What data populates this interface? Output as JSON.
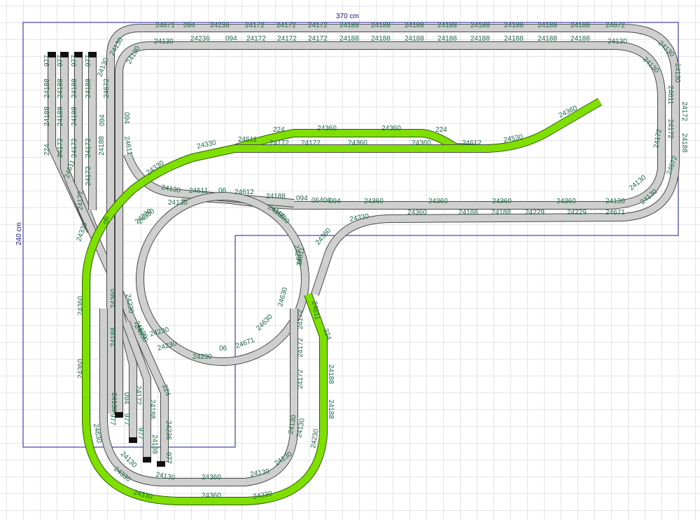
{
  "canvas": {
    "background": "#ffffff",
    "grid_color": "#c9c9d6",
    "board_outline_color": "#1a1aa0",
    "track_color": "#cfcfcf",
    "highlight_color": "#7fe000"
  },
  "dimensions": {
    "width_label": "370 cm",
    "height_label": "240 cm"
  },
  "track_labels": {
    "top_outer": [
      "24671",
      "094",
      "24236",
      "24172",
      "24172",
      "24172",
      "24188",
      "24188",
      "24188",
      "24188",
      "24188",
      "24188",
      "24188",
      "24188",
      "24672"
    ],
    "top_inner": [
      "24130",
      "24236",
      "094",
      "24172",
      "24172",
      "24172",
      "24188",
      "24188",
      "24188",
      "24188",
      "24188",
      "24188",
      "24188",
      "24188",
      "24130"
    ],
    "right_side": [
      "24130",
      "24130",
      "24130",
      "24611",
      "24172",
      "24172",
      "24188",
      "24172",
      "24672",
      "24130",
      "24130",
      "24130"
    ],
    "inner_loop": [
      "24330",
      "24611",
      "224",
      "24172",
      "24360",
      "24172",
      "24360",
      "24360",
      "24360",
      "224",
      "24612",
      "24530",
      "24360"
    ],
    "middle_line": [
      "24130",
      "24611",
      "06",
      "24612",
      "24188",
      "094",
      "06406",
      "094",
      "24360",
      "24360",
      "24360",
      "24360",
      "24130",
      "24130"
    ],
    "lower_middle": [
      "24330",
      "24360",
      "24188",
      "24188",
      "24229",
      "24229",
      "24671"
    ],
    "left_yard": [
      "24188",
      "977",
      "977",
      "977",
      "977",
      "24188",
      "24188",
      "24188",
      "24188",
      "224",
      "24172",
      "24172",
      "24172",
      "24172",
      "24188",
      "24188",
      "094",
      "24611",
      "24330",
      "24172",
      "06"
    ],
    "left_side": [
      "24130",
      "24130",
      "24672",
      "24188",
      "094",
      "24611",
      "24130",
      "24360",
      "24330",
      "24330",
      "24360",
      "24360",
      "24230",
      "24188",
      "24630"
    ],
    "center_loop": [
      "24330",
      "24230",
      "24230",
      "24230",
      "24630",
      "24671",
      "06",
      "24630",
      "24230",
      "24230",
      "24630",
      "24611",
      "24360"
    ],
    "bottom_yard": [
      "24172",
      "24130",
      "094",
      "977",
      "24188",
      "977",
      "24236",
      "977",
      "24188",
      "224",
      "977"
    ],
    "bottom_loop": [
      "24630",
      "24330",
      "24130",
      "24360",
      "24130",
      "24130",
      "24330",
      "24360",
      "24230",
      "24130",
      "24130"
    ],
    "right_lower_vertical": [
      "24611",
      "224",
      "24172",
      "24172",
      "24172",
      "24188",
      "24188",
      "24130",
      "24230"
    ]
  }
}
